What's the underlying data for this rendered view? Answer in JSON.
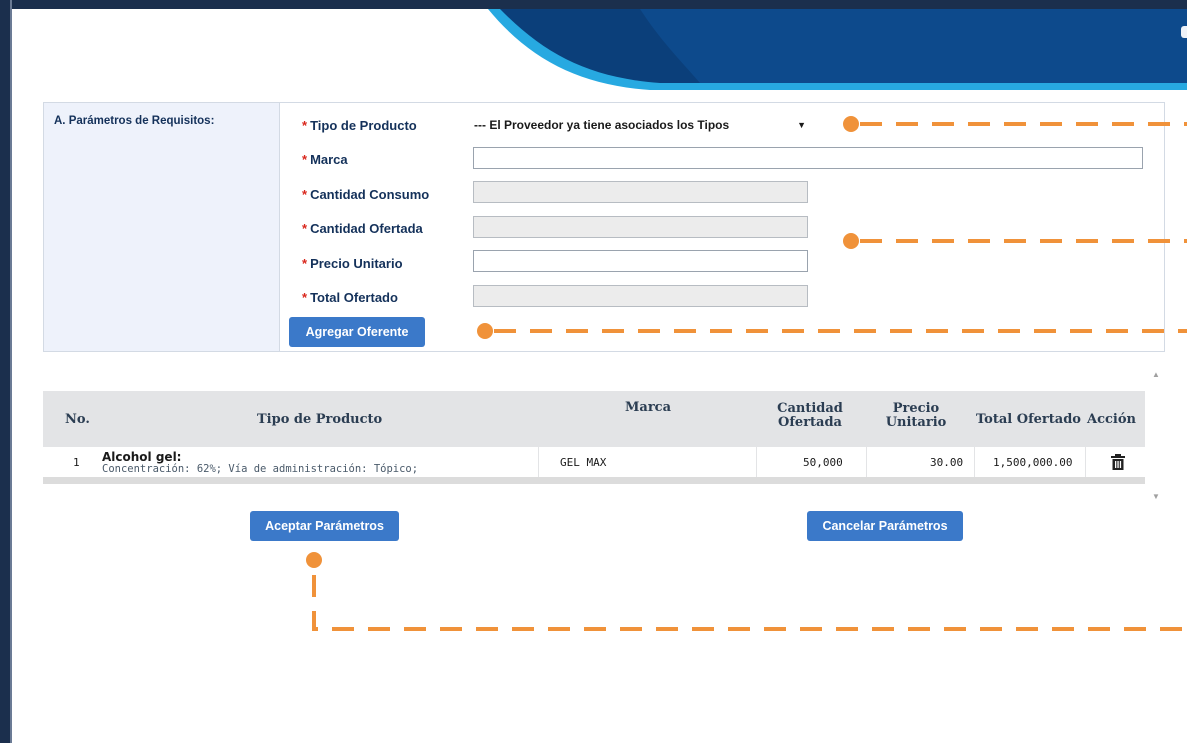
{
  "colors": {
    "header_navy": "#0b4a8b",
    "header_cyan": "#27a9e1",
    "button_blue": "#3b79c9",
    "required_red": "#d9261c",
    "label_navy": "#14315a",
    "annotation_orange": "#f0923a"
  },
  "params": {
    "section_title": "A. Parámetros de Requisitos:",
    "required_mark": "*",
    "fields": {
      "tipo_producto": {
        "label": "Tipo de Producto",
        "value": "--- El Proveedor ya tiene asociados los Tipos"
      },
      "marca": {
        "label": "Marca",
        "value": ""
      },
      "cantidad_consumo": {
        "label": "Cantidad Consumo",
        "value": ""
      },
      "cantidad_ofertada": {
        "label": "Cantidad Ofertada",
        "value": ""
      },
      "precio_unitario": {
        "label": "Precio Unitario",
        "value": ""
      },
      "total_ofertado": {
        "label": "Total Ofertado",
        "value": ""
      }
    },
    "add_button": "Agregar Oferente"
  },
  "table": {
    "headers": {
      "no": "No.",
      "tipo_producto": "Tipo de Producto",
      "marca": "Marca",
      "cantidad_ofertada_1": "Cantidad",
      "cantidad_ofertada_2": "Ofertada",
      "precio_unitario_1": "Precio",
      "precio_unitario_2": "Unitario",
      "total_ofertado": "Total Ofertado",
      "accion": "Acción"
    },
    "rows": [
      {
        "no": "1",
        "producto": "Alcohol gel:",
        "detalle": "Concentración: 62%; Vía de administración: Tópico;",
        "marca": "GEL MAX",
        "cantidad_ofertada": "50,000",
        "precio_unitario": "30.00",
        "total_ofertado": "1,500,000.00",
        "accion_icon": "trash-icon"
      }
    ]
  },
  "actions": {
    "accept": "Aceptar Parámetros",
    "cancel": "Cancelar Parámetros"
  }
}
